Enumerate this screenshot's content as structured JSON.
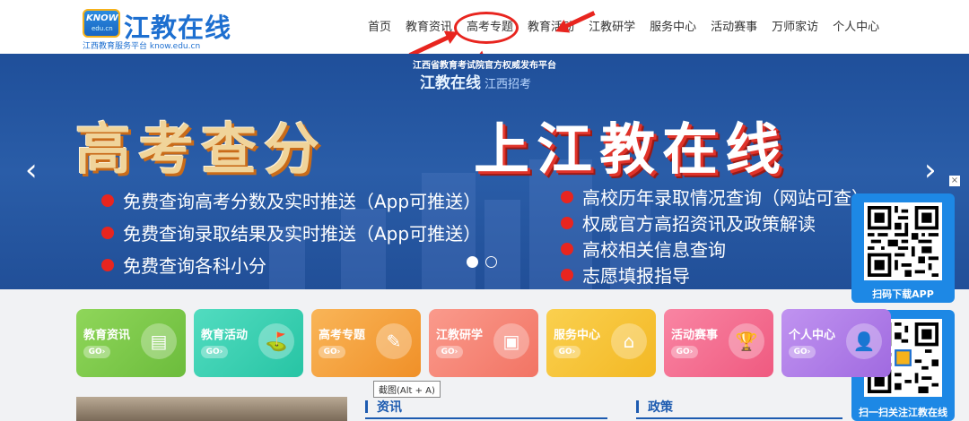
{
  "header": {
    "logo_badge_top": "KNOW",
    "logo_badge_bottom": "edu.cn",
    "logo_name": "江教在线",
    "logo_sub": "江西教育服务平台 know.edu.cn",
    "nav": [
      "首页",
      "教育资讯",
      "高考专题",
      "教育活动",
      "江教研学",
      "服务中心",
      "活动赛事",
      "万师家访",
      "个人中心"
    ],
    "highlight_color": "#e8251f"
  },
  "banner": {
    "top_line": "江西省教育考试院官方权威发布平台",
    "logo": "江教在线",
    "logo_sub": "江西招考",
    "headline_left": "高考查分",
    "headline_right": "上江教在线",
    "bullets_left": [
      "免费查询高考分数及实时推送（App可推送）",
      "免费查询录取结果及实时推送（App可推送）",
      "免费查询各科小分"
    ],
    "bullets_right": [
      "高校历年录取情况查询（网站可查）",
      "权威官方高招资讯及政策解读",
      "高校相关信息查询",
      "志愿填报指导"
    ],
    "prev_icon": "‹",
    "next_icon": "›"
  },
  "qr": {
    "close": "×",
    "app_label": "扫码下载APP",
    "follow_label": "扫一扫关注江教在线"
  },
  "tiles": [
    {
      "title": "教育资讯",
      "go": "GO›",
      "icon": "▤",
      "color": "#7cc94a"
    },
    {
      "title": "教育活动",
      "go": "GO›",
      "icon": "⛳",
      "color": "#3ccfb0"
    },
    {
      "title": "高考专题",
      "go": "GO›",
      "icon": "✎",
      "color": "#f5a540"
    },
    {
      "title": "江教研学",
      "go": "GO›",
      "icon": "▣",
      "color": "#f6877a"
    },
    {
      "title": "服务中心",
      "go": "GO›",
      "icon": "⌂",
      "color": "#f5c437"
    },
    {
      "title": "活动赛事",
      "go": "GO›",
      "icon": "🏆",
      "color": "#f46d8f"
    },
    {
      "title": "个人中心",
      "go": "GO›",
      "icon": "👤",
      "color": "#b07de6"
    }
  ],
  "tooltip": "截图(Alt + A)",
  "sections": {
    "news": "资讯",
    "policy": "政策"
  }
}
